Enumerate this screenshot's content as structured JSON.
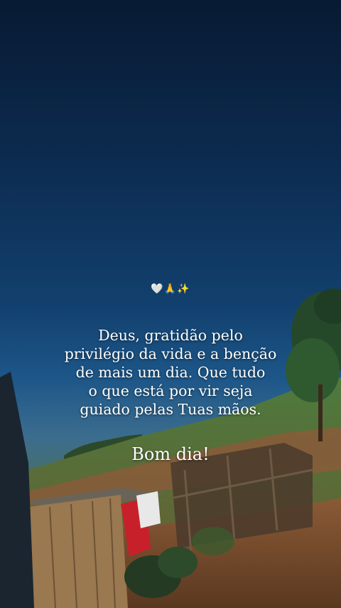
{
  "overlay": {
    "emojis": "🤍🙏✨",
    "quote_lines": [
      "Deus, gratidão pelo",
      "privilégio da vida e a benção",
      "de mais um dia. Que tudo",
      "o que está por vir seja",
      "guiado pelas Tuas mãos."
    ],
    "greeting": "Bom dia!"
  },
  "colors": {
    "sky_top": "#081a33",
    "sky_mid": "#12406e",
    "field": "#5e7a3a",
    "soil": "#7a5232",
    "text": "#ffffff"
  }
}
